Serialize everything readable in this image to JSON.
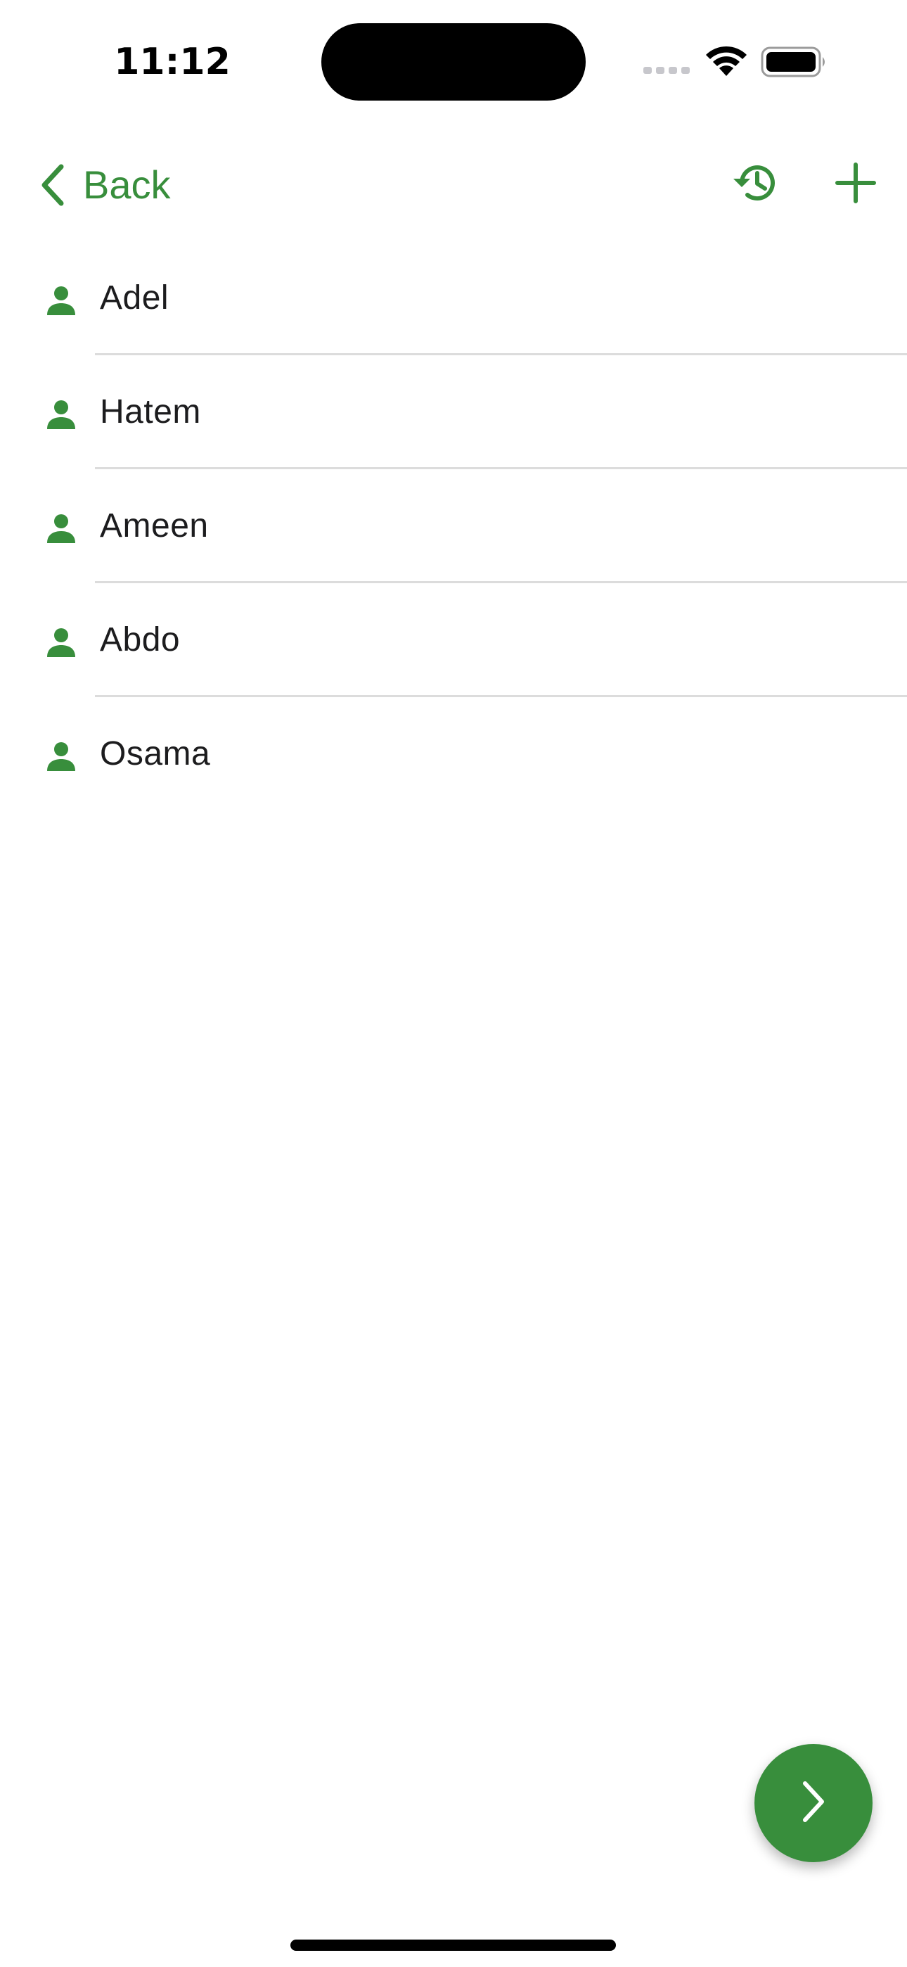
{
  "status_bar": {
    "time": "11:12",
    "icons": [
      "cellular-signal-icon",
      "wifi-icon",
      "battery-icon"
    ]
  },
  "nav": {
    "back_label": "Back",
    "back_icon": "chevron-left-icon",
    "actions": [
      "history-icon",
      "plus-icon"
    ]
  },
  "people": [
    {
      "name": "Adel",
      "icon": "person-icon"
    },
    {
      "name": "Hatem",
      "icon": "person-icon"
    },
    {
      "name": "Ameen",
      "icon": "person-icon"
    },
    {
      "name": "Abdo",
      "icon": "person-icon"
    },
    {
      "name": "Osama",
      "icon": "person-icon"
    }
  ],
  "fab": {
    "icon": "chevron-right-icon"
  },
  "colors": {
    "accent": "#388e3c",
    "text": "#1c1c1e",
    "divider": "#dcdcdc",
    "background": "#ffffff"
  }
}
